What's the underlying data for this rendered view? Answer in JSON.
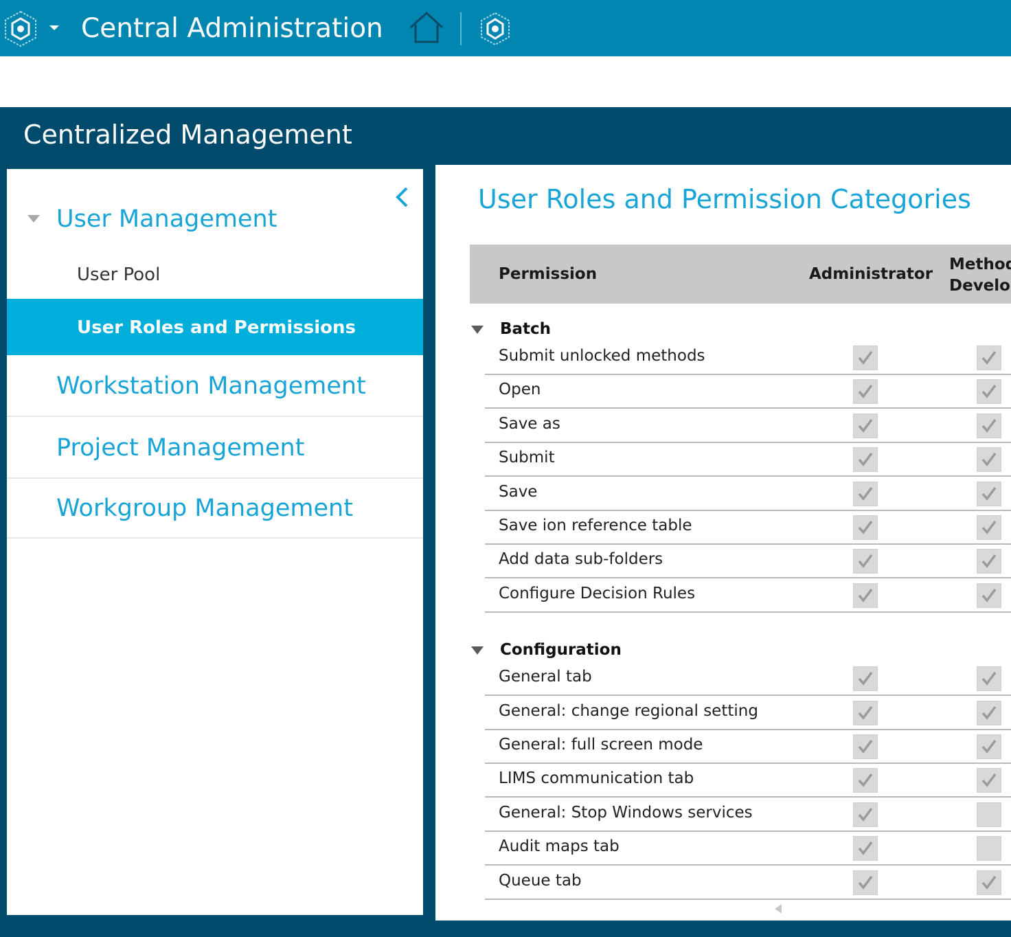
{
  "app": {
    "title": "Central Administration",
    "brand_color": "#0086b0",
    "header_color": "#004b6c",
    "accent_color": "#00aedb",
    "icons": [
      "hexagon-logo-icon",
      "chevron-down-icon",
      "home-icon",
      "hexagon-settings-icon"
    ]
  },
  "section": {
    "title": "Centralized Management"
  },
  "sidebar": {
    "collapse_icon": "chevron-left-icon",
    "user_management": {
      "label": "User Management",
      "expanded": true,
      "children": [
        {
          "label": "User Pool",
          "active": false
        },
        {
          "label": "User Roles and Permissions",
          "active": true
        }
      ]
    },
    "items": [
      {
        "label": "Workstation Management"
      },
      {
        "label": "Project Management"
      },
      {
        "label": "Workgroup Management"
      }
    ]
  },
  "main": {
    "title": "User Roles and Permission Categories",
    "table": {
      "columns": [
        "Permission",
        "Administrator",
        "Method\nDevelop"
      ],
      "groups": [
        {
          "name": "Batch",
          "rows": [
            {
              "label": "Submit unlocked methods",
              "checks": [
                true,
                true
              ]
            },
            {
              "label": "Open",
              "checks": [
                true,
                true
              ]
            },
            {
              "label": "Save as",
              "checks": [
                true,
                true
              ]
            },
            {
              "label": "Submit",
              "checks": [
                true,
                true
              ]
            },
            {
              "label": "Save",
              "checks": [
                true,
                true
              ]
            },
            {
              "label": "Save ion reference table",
              "checks": [
                true,
                true
              ]
            },
            {
              "label": "Add data sub-folders",
              "checks": [
                true,
                true
              ]
            },
            {
              "label": "Configure Decision Rules",
              "checks": [
                true,
                true
              ]
            }
          ]
        },
        {
          "name": "Configuration",
          "rows": [
            {
              "label": "General tab",
              "checks": [
                true,
                true
              ]
            },
            {
              "label": "General: change regional setting",
              "checks": [
                true,
                true
              ]
            },
            {
              "label": "General: full screen mode",
              "checks": [
                true,
                true
              ]
            },
            {
              "label": "LIMS communication tab",
              "checks": [
                true,
                true
              ]
            },
            {
              "label": "General: Stop Windows services",
              "checks": [
                true,
                false
              ]
            },
            {
              "label": "Audit maps tab",
              "checks": [
                true,
                false
              ]
            },
            {
              "label": "Queue tab",
              "checks": [
                true,
                true
              ]
            }
          ]
        }
      ]
    }
  }
}
